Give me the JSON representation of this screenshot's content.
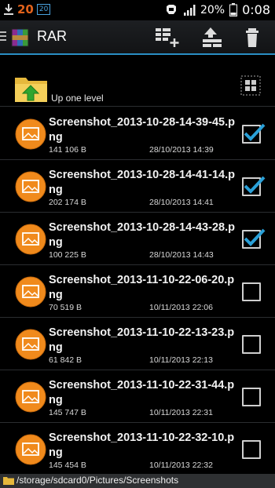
{
  "status_bar": {
    "notification_count": "20",
    "notification_badge": "20",
    "battery": "20%",
    "time": "0:08",
    "icons": [
      "download-icon",
      "notification-badge-icon",
      "alarm-icon",
      "signal-icon",
      "battery-icon"
    ]
  },
  "action_bar": {
    "title": "RAR",
    "icons": [
      "drawer-icon",
      "rar-logo-icon",
      "add-to-archive-icon",
      "extract-icon",
      "delete-icon"
    ]
  },
  "up_row": {
    "label": "Up one level"
  },
  "files": [
    {
      "name": "Screenshot_2013-10-28-14-39-45.png",
      "size": "141 106 B",
      "date": "28/10/2013 14:39",
      "checked": true
    },
    {
      "name": "Screenshot_2013-10-28-14-41-14.png",
      "size": "202 174 B",
      "date": "28/10/2013 14:41",
      "checked": true
    },
    {
      "name": "Screenshot_2013-10-28-14-43-28.png",
      "size": "100 225 B",
      "date": "28/10/2013 14:43",
      "checked": true
    },
    {
      "name": "Screenshot_2013-11-10-22-06-20.png",
      "size": "70 519 B",
      "date": "10/11/2013 22:06",
      "checked": false
    },
    {
      "name": "Screenshot_2013-11-10-22-13-23.png",
      "size": "61 842 B",
      "date": "10/11/2013 22:13",
      "checked": false
    },
    {
      "name": "Screenshot_2013-11-10-22-31-44.png",
      "size": "145 747 B",
      "date": "10/11/2013 22:31",
      "checked": false
    },
    {
      "name": "Screenshot_2013-11-10-22-32-10.png",
      "size": "145 454 B",
      "date": "10/11/2013 22:32",
      "checked": false
    }
  ],
  "path": "/storage/sdcard0/Pictures/Screenshots",
  "colors": {
    "accent": "#2a8ec4",
    "check": "#2aa0d8",
    "thumb": "#f08a1c",
    "notification": "#e2621b"
  }
}
